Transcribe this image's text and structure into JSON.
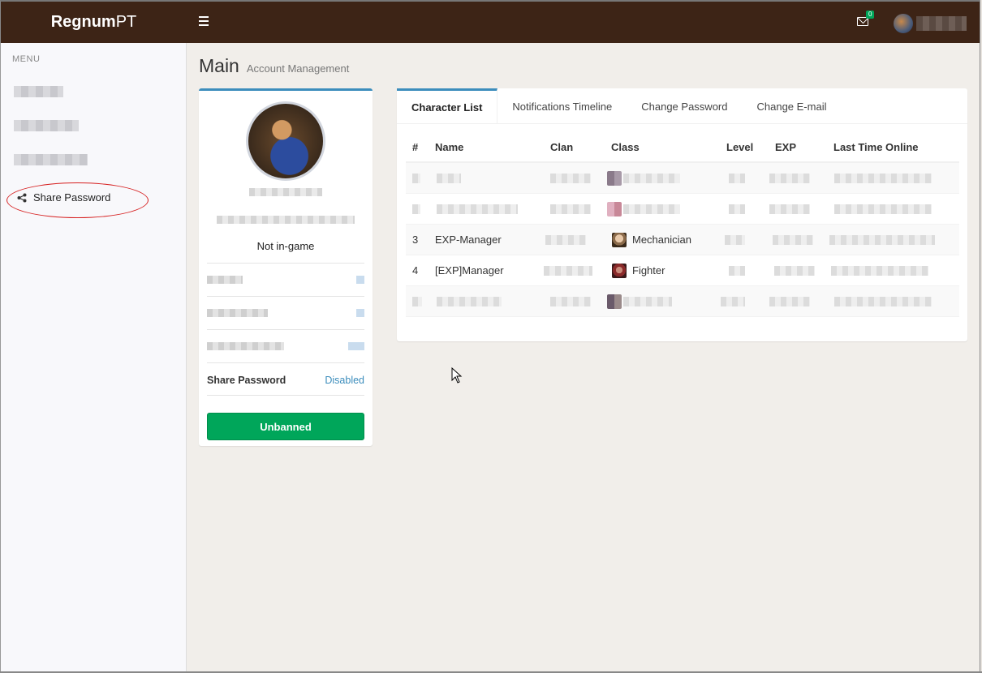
{
  "header": {
    "brand_bold": "Regnum",
    "brand_light": "PT",
    "mail_count": "0"
  },
  "sidebar": {
    "menu_label": "MENU",
    "share_password_label": "Share Password"
  },
  "content": {
    "title": "Main",
    "subtitle": "Account Management"
  },
  "profile": {
    "status": "Not in-game",
    "share_password_label": "Share Password",
    "share_password_value": "Disabled",
    "ban_button_label": "Unbanned"
  },
  "tabs": [
    {
      "label": "Character List",
      "active": true
    },
    {
      "label": "Notifications Timeline"
    },
    {
      "label": "Change Password"
    },
    {
      "label": "Change E-mail"
    }
  ],
  "table": {
    "columns": [
      "#",
      "Name",
      "Clan",
      "Class",
      "Level",
      "EXP",
      "Last Time Online"
    ],
    "rows": [
      {
        "num": "3",
        "name": "EXP-Manager",
        "class": "Mechanician"
      },
      {
        "num": "4",
        "name": "[EXP]Manager",
        "class": "Fighter"
      }
    ]
  },
  "colors": {
    "header_bg": "#3d2416",
    "accent": "#3c8dbc",
    "success": "#00a65a",
    "highlight": "#d62020"
  }
}
